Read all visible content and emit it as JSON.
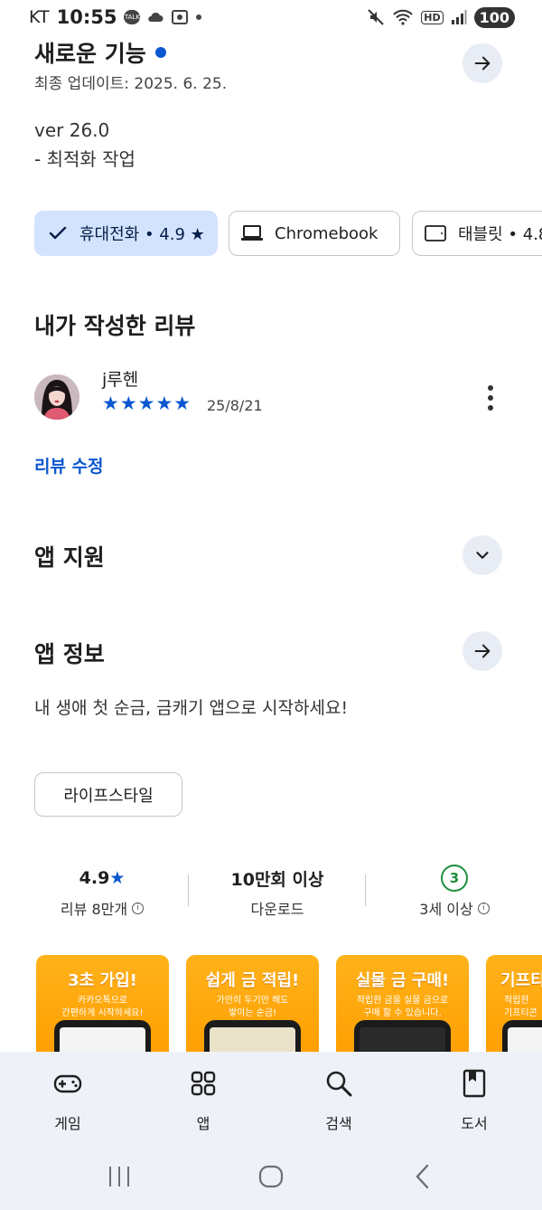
{
  "status_bar": {
    "carrier": "KT",
    "time": "10:55",
    "talk_badge": "TALK",
    "hd_label": "HD",
    "battery": "100"
  },
  "whats_new": {
    "title": "새로운 기능",
    "updated": "최종 업데이트: 2025. 6. 25.",
    "version": "ver 26.0",
    "note": "- 최적화 작업"
  },
  "device_chips": [
    {
      "label": "휴대전화 • 4.9 ★",
      "selected": true,
      "icon": "check-icon"
    },
    {
      "label": "Chromebook",
      "selected": false,
      "icon": "laptop-icon"
    },
    {
      "label": "태블릿 • 4.8",
      "selected": false,
      "icon": "tablet-icon"
    }
  ],
  "my_review": {
    "section_title": "내가 작성한 리뷰",
    "reviewer_name": "j루헨",
    "stars": "★★★★★",
    "rating": 5,
    "date": "25/8/21",
    "edit_label": "리뷰 수정"
  },
  "app_support": {
    "title": "앱 지원"
  },
  "app_info": {
    "title": "앱 정보",
    "description": "내 생애 첫 순금, 금캐기 앱으로 시작하세요!",
    "category": "라이프스타일"
  },
  "stats": [
    {
      "value": "4.9★",
      "label": "리뷰 8만개"
    },
    {
      "value": "10만회 이상",
      "label": "다운로드"
    },
    {
      "value": "3",
      "label": "3세 이상"
    }
  ],
  "screenshots": [
    {
      "title": "3초 가입!",
      "subtitle": "카카오톡으로\n간편하게 시작하세요!"
    },
    {
      "title": "쉽게 금 적립!",
      "subtitle": "가만히 두기만 해도\n쌓이는 순금!"
    },
    {
      "title": "실물 금 구매!",
      "subtitle": "적립한 금을 실물 금으로\n구매 할 수 있습니다."
    },
    {
      "title": "기프티",
      "subtitle": "적립한\n기프티콘"
    }
  ],
  "bottom_nav": [
    {
      "label": "게임",
      "icon": "gamepad-icon"
    },
    {
      "label": "앱",
      "icon": "apps-grid-icon"
    },
    {
      "label": "검색",
      "icon": "search-icon"
    },
    {
      "label": "도서",
      "icon": "book-icon"
    }
  ],
  "colors": {
    "accent": "#0b57d0",
    "chip_selected_bg": "#d3e3fd",
    "nav_bg": "#eef1f8",
    "age_badge": "#1e8e3e",
    "screenshot_orange": "#ffa30a"
  }
}
